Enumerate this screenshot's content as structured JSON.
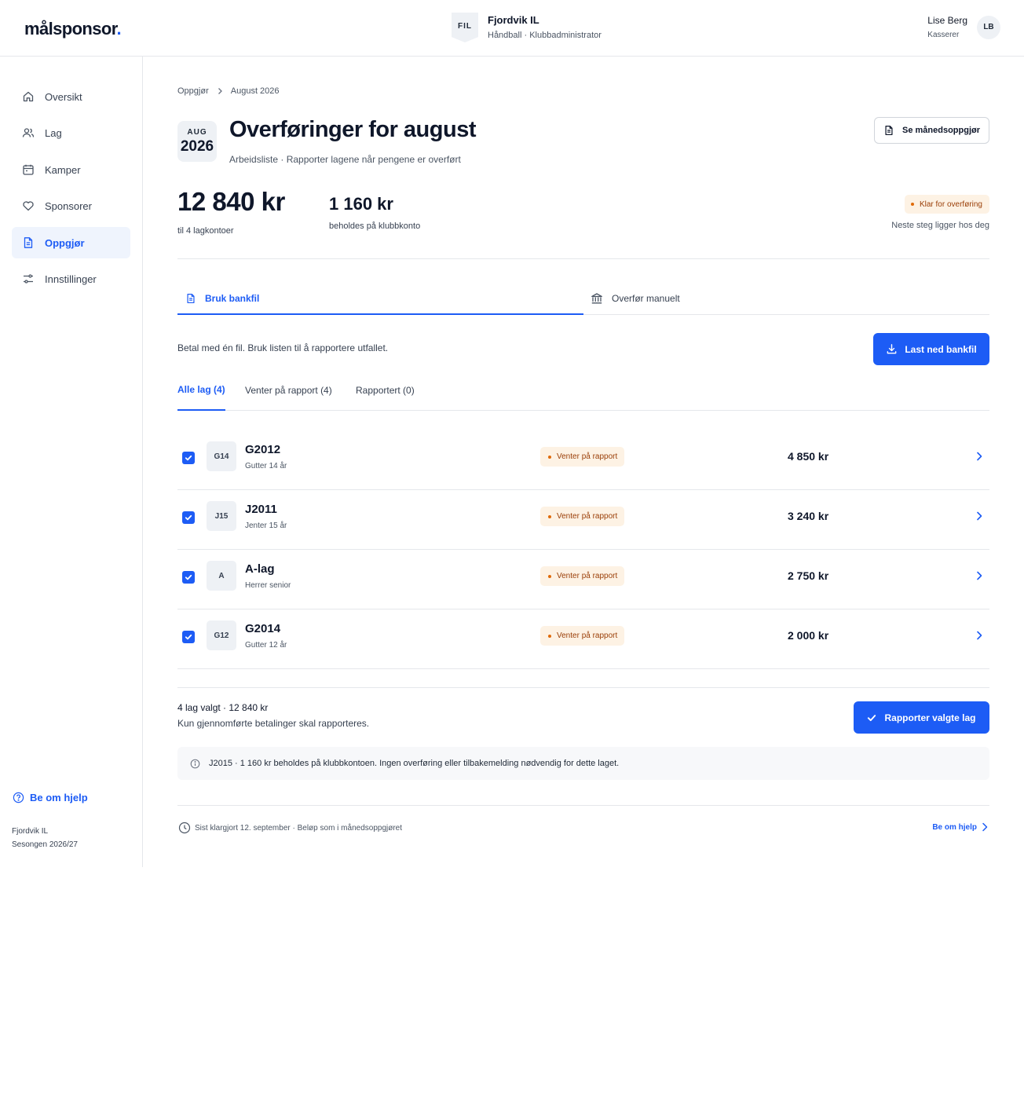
{
  "header": {
    "logo_text": "målsponsor",
    "logo_dot": ".",
    "club_badge": "FIL",
    "club_name": "Fjordvik IL",
    "club_sub": "Håndball · Klubbadministrator",
    "user_name": "Lise Berg",
    "user_role": "Kasserer",
    "user_initials": "LB"
  },
  "sidebar": {
    "items": [
      {
        "label": "Oversikt",
        "icon": "home-icon"
      },
      {
        "label": "Lag",
        "icon": "users-icon"
      },
      {
        "label": "Kamper",
        "icon": "calendar-icon"
      },
      {
        "label": "Sponsorer",
        "icon": "heart-icon"
      },
      {
        "label": "Oppgjør",
        "icon": "document-icon",
        "active": true
      },
      {
        "label": "Innstillinger",
        "icon": "sliders-icon"
      }
    ],
    "help_label": "Be om hjelp",
    "footer_club": "Fjordvik IL",
    "footer_season": "Sesongen 2026/27"
  },
  "breadcrumb": {
    "parent": "Oppgjør",
    "current": "August 2026"
  },
  "page": {
    "cal_month": "AUG",
    "cal_year": "2026",
    "title": "Overføringer for august",
    "subtitle": "Arbeidsliste · Rapporter lagene når pengene er overført",
    "month_button": "Se månedsoppgjør"
  },
  "summary": {
    "total_amount": "12 840 kr",
    "total_label": "til 4 lagkontoer",
    "held_amount": "1 160 kr",
    "held_label": "beholdes på klubbkonto",
    "status": "Klar for overføring",
    "status_next": "Neste steg ligger hos deg"
  },
  "tabs": {
    "bankfile": "Bruk bankfil",
    "manual": "Overfør manuelt"
  },
  "bankfile": {
    "description": "Betal med én fil. Bruk listen til å rapportere utfallet.",
    "download_button": "Last ned bankfil"
  },
  "filters": {
    "all": "Alle lag (4)",
    "pending": "Venter på rapport (4)",
    "reported": "Rapportert (0)"
  },
  "rows": [
    {
      "badge": "G14",
      "name": "G2012",
      "sub": "Gutter 14 år",
      "status": "Venter på rapport",
      "amount": "4 850 kr"
    },
    {
      "badge": "J15",
      "name": "J2011",
      "sub": "Jenter 15 år",
      "status": "Venter på rapport",
      "amount": "3 240 kr"
    },
    {
      "badge": "A",
      "name": "A-lag",
      "sub": "Herrer senior",
      "status": "Venter på rapport",
      "amount": "2 750 kr"
    },
    {
      "badge": "G12",
      "name": "G2014",
      "sub": "Gutter 12 år",
      "status": "Venter på rapport",
      "amount": "2 000 kr"
    }
  ],
  "selection": {
    "count": "4 lag valgt · 12 840 kr",
    "note": "Kun gjennomførte betalinger skal rapporteres.",
    "report_button": "Rapporter valgte lag"
  },
  "info": {
    "text": "J2015 · 1 160 kr beholdes på klubbkontoen. Ingen overføring eller tilbakemelding nødvendig for dette laget."
  },
  "footer": {
    "meta": "Sist klargjort 12. september · Beløp som i månedsoppgjøret",
    "help": "Be om hjelp"
  },
  "colors": {
    "accent": "#1d5cf5",
    "pending_bg": "#fdf2e4",
    "pending_text": "#9a3e07"
  }
}
